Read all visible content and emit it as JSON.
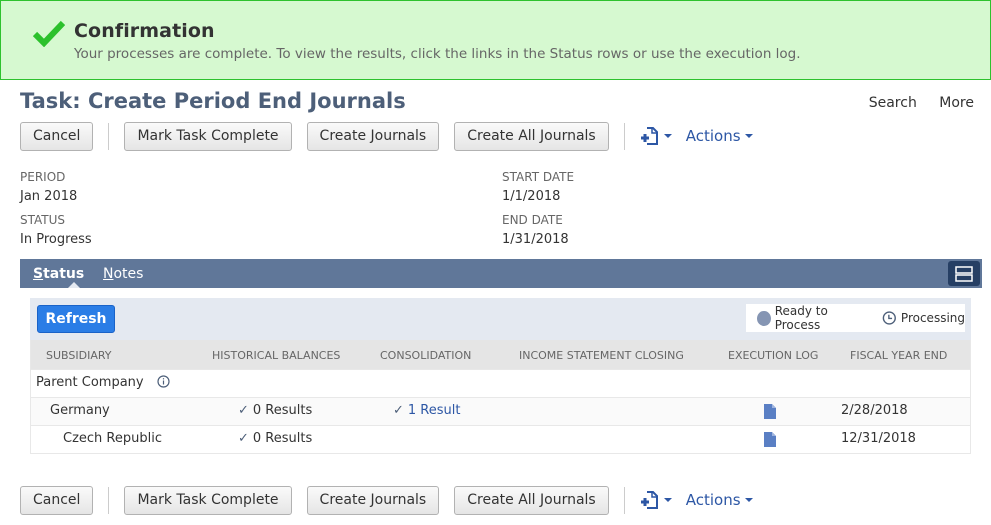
{
  "confirmation": {
    "title": "Confirmation",
    "message": "Your processes are complete. To view the results, click the links in the Status rows or use the execution log."
  },
  "header": {
    "title": "Task: Create Period End Journals",
    "links": [
      "Search",
      "More"
    ]
  },
  "toolbar": {
    "cancel": "Cancel",
    "mark_complete": "Mark Task Complete",
    "create_journals": "Create Journals",
    "create_all_journals": "Create All Journals",
    "actions": "Actions"
  },
  "fields": {
    "period": {
      "label": "PERIOD",
      "value": "Jan 2018"
    },
    "status": {
      "label": "STATUS",
      "value": "In Progress"
    },
    "start_date": {
      "label": "START DATE",
      "value": "1/1/2018"
    },
    "end_date": {
      "label": "END DATE",
      "value": "1/31/2018"
    }
  },
  "tabs": [
    {
      "label_first": "S",
      "label_rest": "tatus",
      "active": true
    },
    {
      "label_first": "N",
      "label_rest": "otes",
      "active": false
    }
  ],
  "panel": {
    "refresh": "Refresh",
    "legend": {
      "ready": "Ready to Process",
      "processing": "Processing"
    }
  },
  "table": {
    "columns": [
      "Subsidiary",
      "Historical Balances",
      "Consolidation",
      "Income Statement Closing",
      "Execution Log",
      "Fiscal Year End"
    ],
    "rows": [
      {
        "subsidiary": "Parent Company",
        "historical": "",
        "consolidation": "",
        "closing": "",
        "log": false,
        "fye": ""
      },
      {
        "subsidiary": "Germany",
        "historical": "0 Results",
        "consolidation": "1 Result",
        "closing": "",
        "log": true,
        "fye": "2/28/2018"
      },
      {
        "subsidiary": "Czech Republic",
        "historical": "0 Results",
        "consolidation": "",
        "closing": "",
        "log": true,
        "fye": "12/31/2018"
      }
    ]
  },
  "colors": {
    "confirm_bg": "#d6f9d0",
    "confirm_border": "#2ec22e",
    "title": "#4d5f79",
    "tabbar": "#607799",
    "link": "#2d57a5",
    "primary_button": "#2a7de6"
  }
}
